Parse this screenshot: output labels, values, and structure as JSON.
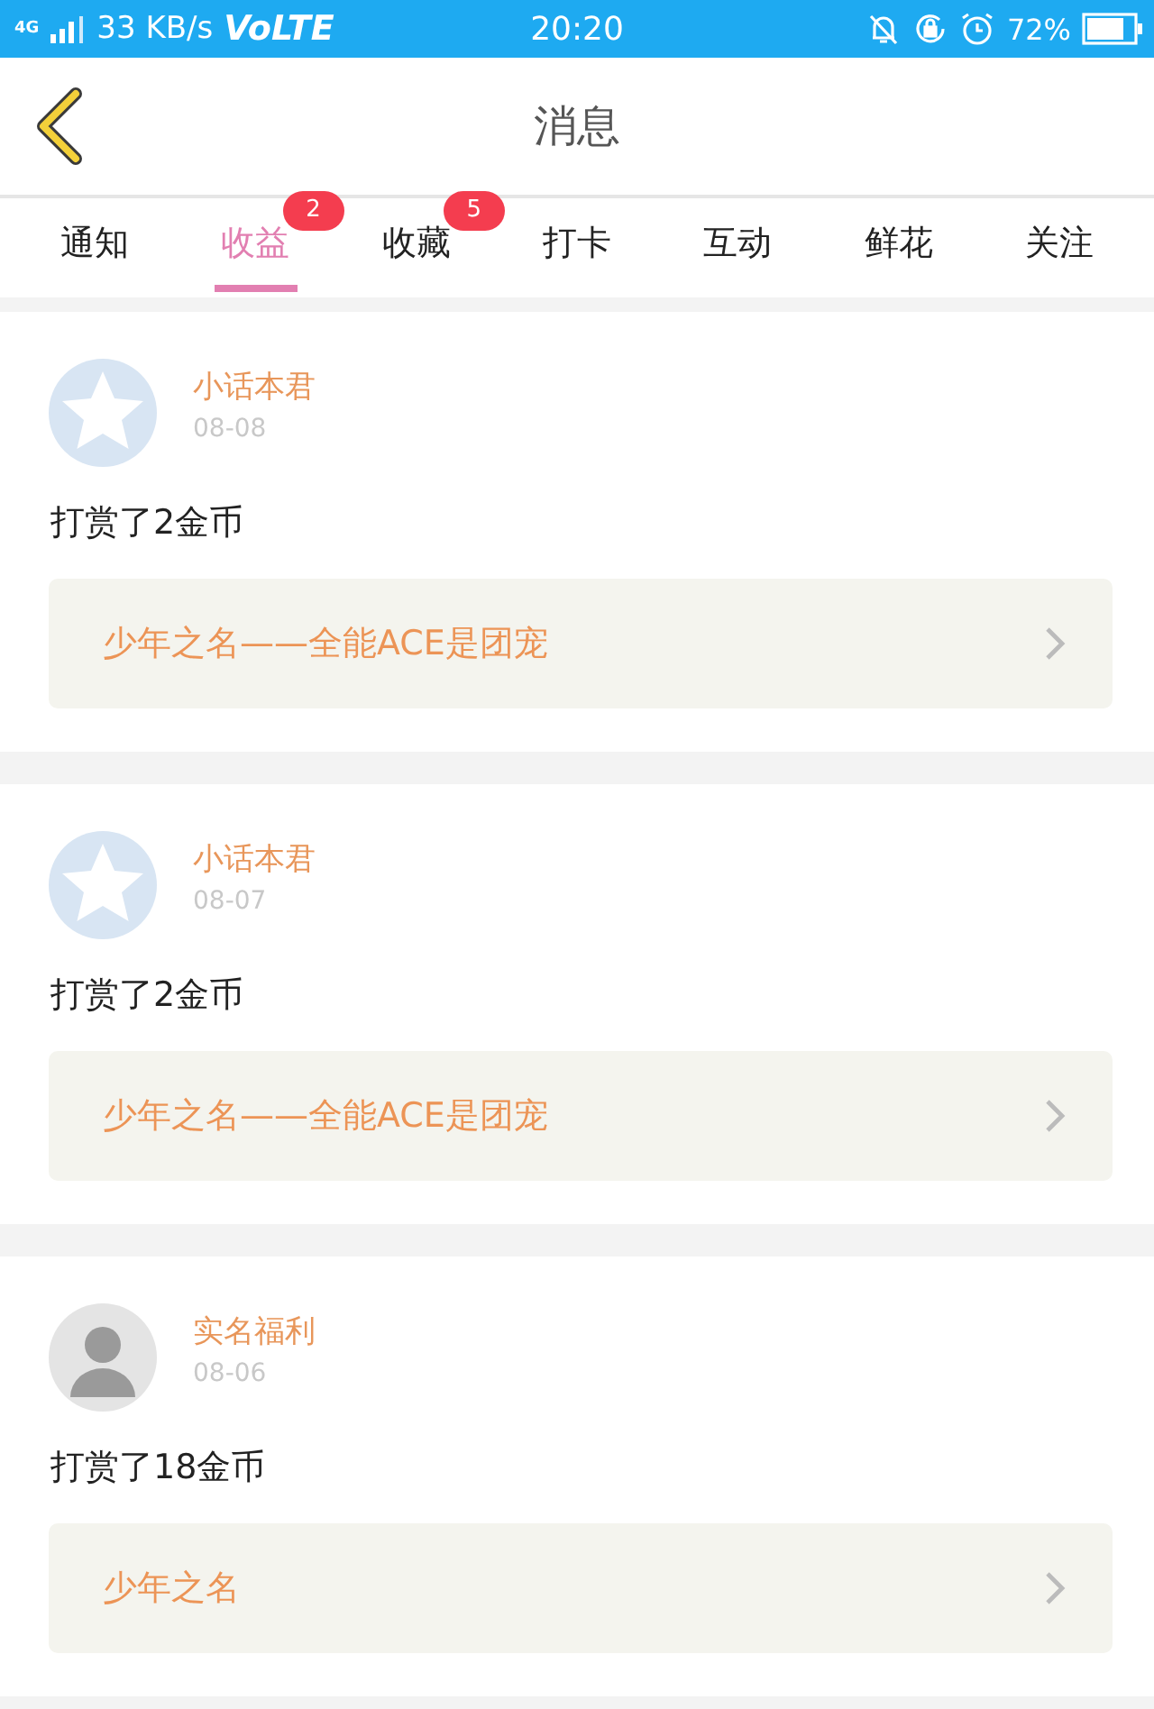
{
  "status_bar": {
    "network": "4G",
    "speed": "33 KB/s",
    "volte": "VoLTE",
    "time": "20:20",
    "battery": "72%"
  },
  "header": {
    "title": "消息"
  },
  "tabs": [
    {
      "label": "通知",
      "selected": false
    },
    {
      "label": "收益",
      "selected": true,
      "badge": "2"
    },
    {
      "label": "收藏",
      "selected": false,
      "badge": "5"
    },
    {
      "label": "打卡",
      "selected": false
    },
    {
      "label": "互动",
      "selected": false
    },
    {
      "label": "鲜花",
      "selected": false
    },
    {
      "label": "关注",
      "selected": false
    }
  ],
  "messages": [
    {
      "avatar": {
        "kind": "star"
      },
      "name": "小话本君",
      "date": "08-08",
      "text": "打赏了2金币",
      "link": "少年之名——全能ACE是团宠"
    },
    {
      "avatar": {
        "kind": "star"
      },
      "name": "小话本君",
      "date": "08-07",
      "text": "打赏了2金币",
      "link": "少年之名——全能ACE是团宠"
    },
    {
      "avatar": {
        "kind": "figure"
      },
      "name": "实名福利",
      "date": "08-06",
      "text": "打赏了18金币",
      "link": "少年之名"
    }
  ]
}
